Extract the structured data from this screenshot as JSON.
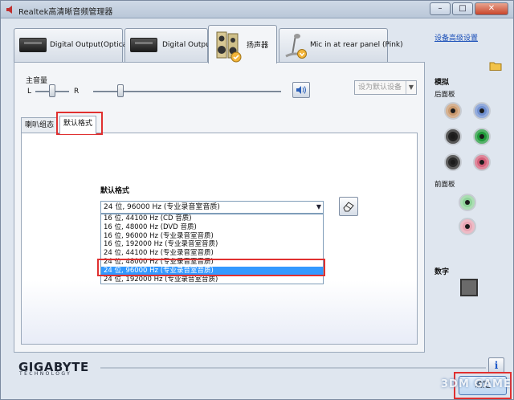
{
  "window": {
    "title": "Realtek高清晰音频管理器",
    "controls": [
      "–",
      "□",
      "✕"
    ]
  },
  "device_tabs": [
    {
      "label": "Digital Output(Optical)"
    },
    {
      "label": "Digital Output"
    },
    {
      "label": "扬声器"
    },
    {
      "label": "Mic in at rear panel (Pink)"
    }
  ],
  "volume": {
    "label": "主音量",
    "left": "L",
    "right": "R",
    "default_device": "设为默认设备"
  },
  "sub_tabs": [
    {
      "label": "喇叭组态"
    },
    {
      "label": "默认格式"
    }
  ],
  "format": {
    "label": "默认格式",
    "selected": "24 位, 96000 Hz (专业录音室音质)",
    "options": [
      "16 位, 44100 Hz (CD 音质)",
      "16 位, 48000 Hz (DVD 音质)",
      "16 位, 96000 Hz (专业录音室音质)",
      "16 位, 192000 Hz (专业录音室音质)",
      "24 位, 44100 Hz (专业录音室音质)",
      "24 位, 48000 Hz (专业录音室音质)",
      "24 位, 96000 Hz (专业录音室音质)",
      "24 位, 192000 Hz (专业录音室音质)"
    ],
    "highlighted_index": 6
  },
  "side": {
    "advanced_link": "设备高级设置",
    "analog_title": "模拟",
    "rear_panel": "后面板",
    "front_panel": "前面板",
    "digital_title": "数字",
    "rear_jacks": [
      "#c9996e",
      "#6f8fd0",
      "#222222",
      "#1f9a3a",
      "#2a2a2a",
      "#d4607a"
    ],
    "front_jacks": [
      "#8fd39a",
      "#e7a5b3"
    ]
  },
  "footer": {
    "brand": "GIGABYTE",
    "brand_sub": "TECHNOLOGY",
    "info": "i",
    "ok": "确定",
    "watermark": "3DM GAME"
  },
  "colors": {
    "highlight": "#3399ff",
    "annotation": "#e03030",
    "link": "#1a4fb8"
  }
}
